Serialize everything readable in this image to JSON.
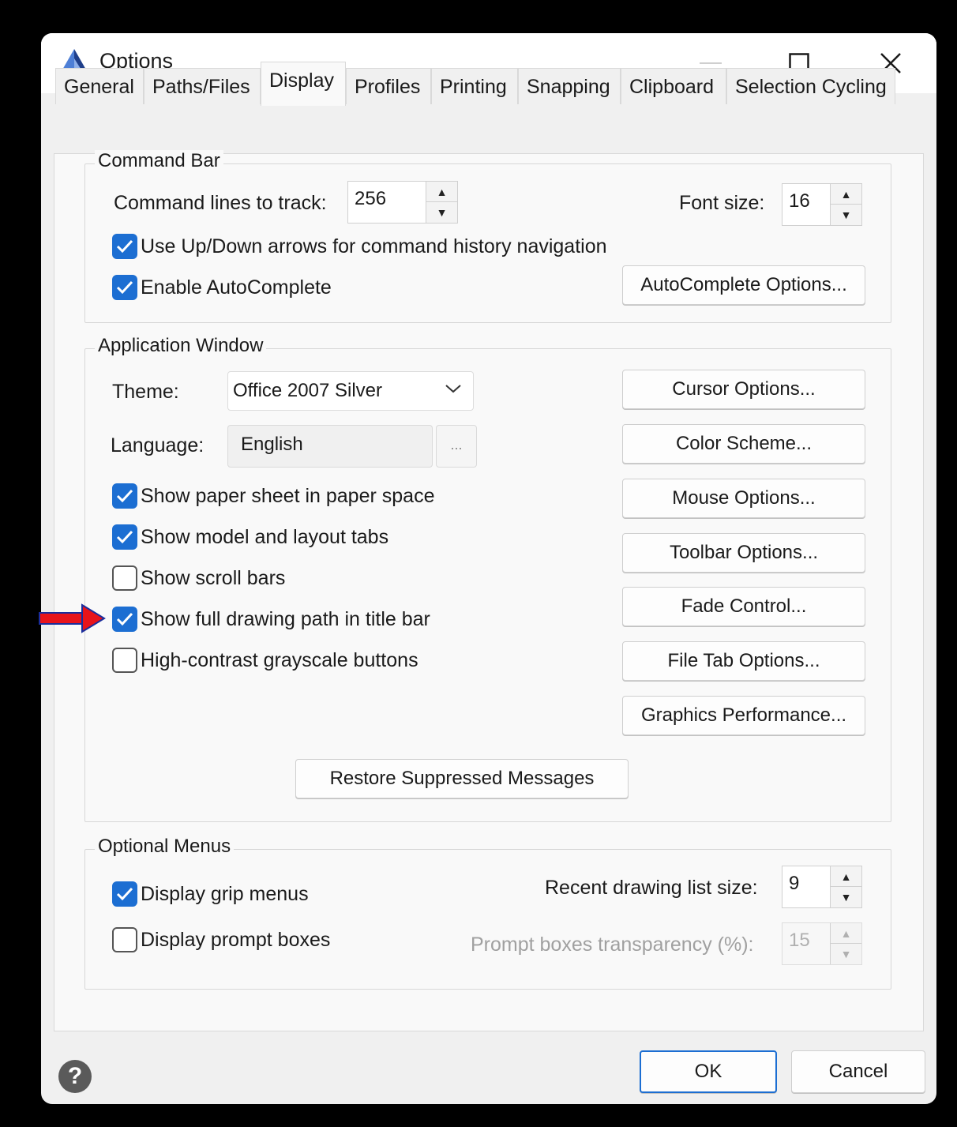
{
  "window": {
    "title": "Options",
    "icon": "app-pyramid-icon",
    "controls": {
      "minimize": "minimize-icon",
      "maximize": "maximize-icon",
      "close": "close-icon"
    }
  },
  "tabs": [
    {
      "label": "General"
    },
    {
      "label": "Paths/Files"
    },
    {
      "label": "Display",
      "active": true
    },
    {
      "label": "Profiles"
    },
    {
      "label": "Printing"
    },
    {
      "label": "Snapping"
    },
    {
      "label": "Clipboard"
    },
    {
      "label": "Selection Cycling"
    }
  ],
  "command_bar": {
    "legend": "Command Bar",
    "lines_label": "Command lines to track:",
    "lines_value": "256",
    "font_label": "Font size:",
    "font_value": "16",
    "updown_label": "Use Up/Down arrows for command history navigation",
    "updown_checked": true,
    "autocomplete_label": "Enable AutoComplete",
    "autocomplete_checked": true,
    "autocomplete_options": "AutoComplete Options..."
  },
  "app_window": {
    "legend": "Application Window",
    "theme_label": "Theme:",
    "theme_value": "Office 2007 Silver",
    "language_label": "Language:",
    "language_value": "English",
    "language_more": "...",
    "checks": [
      {
        "label": "Show paper sheet in paper space",
        "checked": true
      },
      {
        "label": "Show model and layout tabs",
        "checked": true
      },
      {
        "label": "Show scroll bars",
        "checked": false
      },
      {
        "label": "Show full drawing path in title bar",
        "checked": true
      },
      {
        "label": "High-contrast grayscale buttons",
        "checked": false
      }
    ],
    "buttons": [
      "Cursor Options...",
      "Color Scheme...",
      "Mouse Options...",
      "Toolbar Options...",
      "Fade Control...",
      "File Tab Options...",
      "Graphics Performance..."
    ],
    "restore": "Restore Suppressed Messages"
  },
  "optional_menus": {
    "legend": "Optional Menus",
    "grip_label": "Display grip menus",
    "grip_checked": true,
    "prompt_label": "Display prompt boxes",
    "prompt_checked": false,
    "recent_label": "Recent drawing list size:",
    "recent_value": "9",
    "transparency_label": "Prompt boxes transparency (%):",
    "transparency_value": "15"
  },
  "footer": {
    "help": "?",
    "ok": "OK",
    "cancel": "Cancel"
  },
  "colors": {
    "accent": "#1c6ed2",
    "annotation_arrow": "#e8141b"
  }
}
